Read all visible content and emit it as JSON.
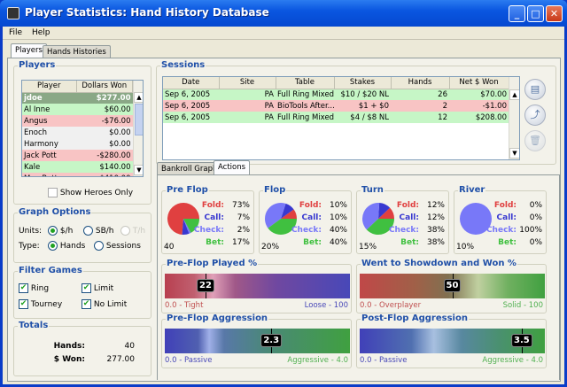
{
  "window": {
    "title": "Player Statistics: Hand History Database"
  },
  "menu": [
    "File",
    "Help"
  ],
  "tabs": [
    "Players",
    "Hands Histories"
  ],
  "players": {
    "title": "Players",
    "columns": [
      "Player",
      "Dollars Won"
    ],
    "rows": [
      {
        "name": "jdoe",
        "won": "$277.00",
        "type": "sel"
      },
      {
        "name": "Al Inne",
        "won": "$60.00",
        "type": "pos"
      },
      {
        "name": "Angus",
        "won": "-$76.00",
        "type": "neg"
      },
      {
        "name": "Enoch",
        "won": "$0.00",
        "type": "zero"
      },
      {
        "name": "Harmony",
        "won": "$0.00",
        "type": "zero"
      },
      {
        "name": "Jack Pott",
        "won": "-$280.00",
        "type": "neg"
      },
      {
        "name": "Kale",
        "won": "$140.00",
        "type": "pos"
      },
      {
        "name": "Max Bette",
        "won": "-$410.00",
        "type": "neg"
      }
    ],
    "show_heroes_label": "Show Heroes Only",
    "show_heroes_checked": false
  },
  "graph_options": {
    "title": "Graph Options",
    "units_label": "Units:",
    "units": [
      "$/h",
      "SB/h",
      "T/h"
    ],
    "units_selected": "$/h",
    "type_label": "Type:",
    "types": [
      "Hands",
      "Sessions"
    ],
    "type_selected": "Hands"
  },
  "filter_games": {
    "title": "Filter Games",
    "items": [
      {
        "label": "Ring",
        "checked": true
      },
      {
        "label": "Limit",
        "checked": true
      },
      {
        "label": "Tourney",
        "checked": true
      },
      {
        "label": "No Limit",
        "checked": true
      }
    ]
  },
  "totals": {
    "title": "Totals",
    "hands_label": "Hands:",
    "hands": "40",
    "won_label": "$ Won:",
    "won": "277.00"
  },
  "sessions": {
    "title": "Sessions",
    "columns": [
      "Date",
      "Site",
      "Table",
      "Stakes",
      "Hands",
      "Net $ Won"
    ],
    "rows": [
      {
        "cells": [
          "Sep 6, 2005",
          "PA",
          "Full Ring Mixed",
          "$10 / $20 NL",
          "26",
          "$70.00"
        ],
        "type": "pos"
      },
      {
        "cells": [
          "Sep 6, 2005",
          "PA",
          "BioTools After...",
          "$1 + $0",
          "2",
          "-$1.00"
        ],
        "type": "neg"
      },
      {
        "cells": [
          "Sep 6, 2005",
          "PA",
          "Full Ring Mixed",
          "$4 / $8 NL",
          "12",
          "$208.00"
        ],
        "type": "pos"
      }
    ],
    "buttons": [
      "details-icon",
      "export-icon",
      "delete-icon"
    ]
  },
  "subtabs": [
    "Bankroll Graph",
    "Actions"
  ],
  "colors": {
    "fold": "#e04040",
    "call": "#3838d0",
    "check": "#7878f8",
    "bet": "#40c040"
  },
  "streets": [
    {
      "title": "Pre Flop",
      "fold": "73%",
      "call": "7%",
      "check": "2%",
      "bet": "17%",
      "count": "40",
      "values": [
        73,
        7,
        2,
        17
      ]
    },
    {
      "title": "Flop",
      "fold": "10%",
      "call": "10%",
      "check": "40%",
      "bet": "40%",
      "count": "20%",
      "values": [
        10,
        10,
        40,
        40
      ]
    },
    {
      "title": "Turn",
      "fold": "12%",
      "call": "12%",
      "check": "38%",
      "bet": "38%",
      "count": "15%",
      "values": [
        12,
        12,
        38,
        38
      ]
    },
    {
      "title": "River",
      "fold": "0%",
      "call": "0%",
      "check": "100%",
      "bet": "0%",
      "count": "10%",
      "values": [
        0,
        0,
        100,
        0
      ]
    }
  ],
  "labels": {
    "fold": "Fold:",
    "call": "Call:",
    "check": "Check:",
    "bet": "Bet:"
  },
  "meters": [
    {
      "title": "Pre-Flop Played %",
      "value": 22,
      "display": "22",
      "max": 100,
      "min_label": "0.0 - Tight",
      "max_label": "Loose - 100",
      "min_color": "#c05050",
      "max_color": "#4848b8"
    },
    {
      "title": "Went to Showdown and Won %",
      "value": 50,
      "display": "50",
      "max": 100,
      "min_label": "0.0 - Overplayer",
      "max_label": "Solid - 100",
      "min_color": "#c05050",
      "max_color": "#50b050"
    },
    {
      "title": "Pre-Flop Aggression",
      "value": 2.3,
      "display": "2.3",
      "max": 4,
      "min_label": "0.0 - Passive",
      "max_label": "Aggressive - 4.0",
      "min_color": "#4848b8",
      "max_color": "#50b050"
    },
    {
      "title": "Post-Flop Aggression",
      "value": 3.5,
      "display": "3.5",
      "max": 4,
      "min_label": "0.0 - Passive",
      "max_label": "Aggressive - 4.0",
      "min_color": "#4848b8",
      "max_color": "#50b050"
    }
  ]
}
